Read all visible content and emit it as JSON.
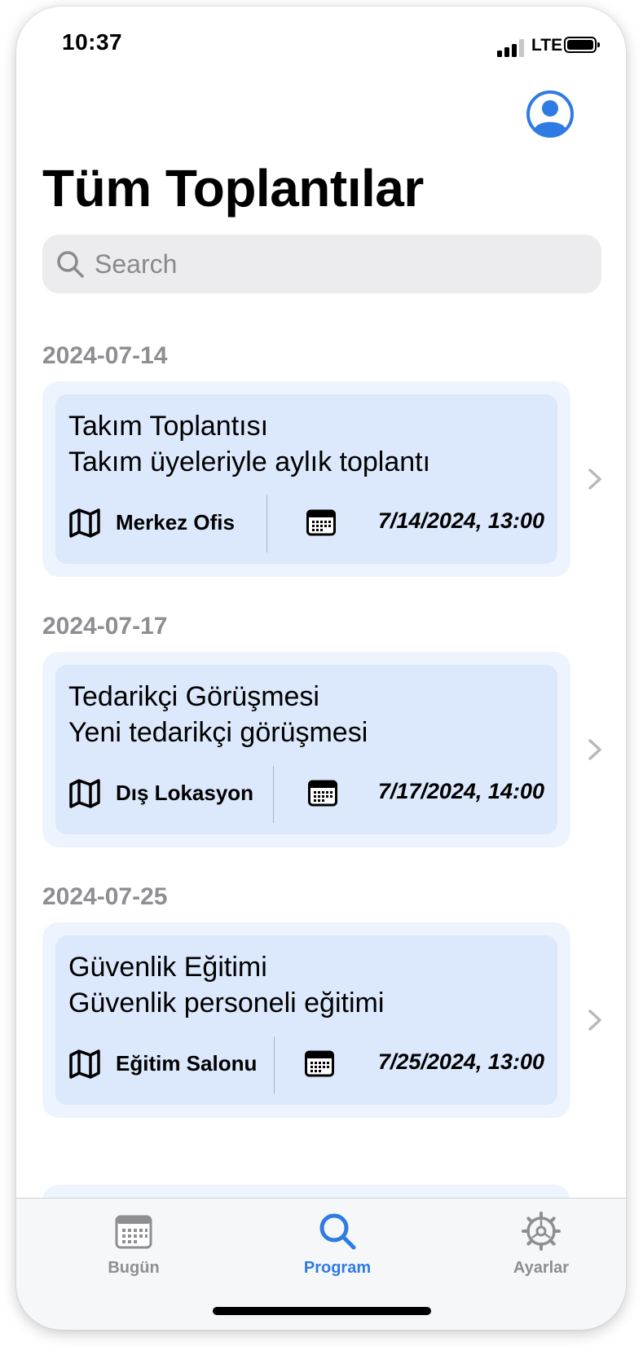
{
  "status_bar": {
    "time": "10:37",
    "network": "LTE"
  },
  "header": {
    "title": "Tüm Toplantılar",
    "profile_icon": "person-circle-icon"
  },
  "search": {
    "placeholder": "Search"
  },
  "colors": {
    "accent": "#2f7be4",
    "card_outer": "#eef4fd",
    "card_inner": "#dce8fb",
    "section_header": "#8e8e93"
  },
  "sections": [
    {
      "date": "2024-07-14",
      "meeting": {
        "title": "Takım Toplantısı",
        "description": "Takım üyeleriyle aylık toplantı",
        "location": "Merkez Ofis",
        "datetime": "7/14/2024, 13:00"
      }
    },
    {
      "date": "2024-07-17",
      "meeting": {
        "title": "Tedarikçi Görüşmesi",
        "description": "Yeni tedarikçi görüşmesi",
        "location": "Dış Lokasyon",
        "datetime": "7/17/2024, 14:00"
      }
    },
    {
      "date": "2024-07-25",
      "meeting": {
        "title": "Güvenlik Eğitimi",
        "description": "Güvenlik personeli eğitimi",
        "location": "Eğitim Salonu",
        "datetime": "7/25/2024, 13:00"
      }
    }
  ],
  "tabs": [
    {
      "label": "Bugün",
      "icon": "calendar-icon",
      "active": false
    },
    {
      "label": "Program",
      "icon": "search-icon",
      "active": true
    },
    {
      "label": "Ayarlar",
      "icon": "gear-icon",
      "active": false
    }
  ]
}
